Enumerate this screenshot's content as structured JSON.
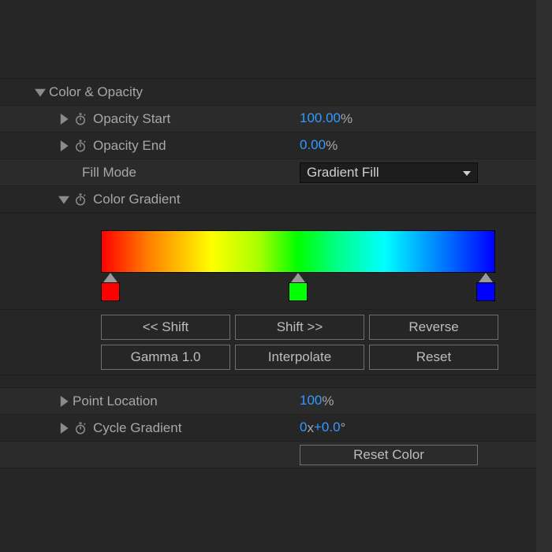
{
  "section": {
    "title": "Color & Opacity"
  },
  "props": {
    "opacityStart": {
      "label": "Opacity Start",
      "value": "100.00",
      "unit": "%"
    },
    "opacityEnd": {
      "label": "Opacity End",
      "value": "0.00",
      "unit": "%"
    },
    "fillMode": {
      "label": "Fill Mode",
      "value": "Gradient Fill"
    },
    "colorGradient": {
      "label": "Color Gradient"
    },
    "pointLocation": {
      "label": "Point Location",
      "value": "100",
      "unit": "%"
    },
    "cycleGradient": {
      "label": "Cycle Gradient",
      "value": "0",
      "sep": "x",
      "angle": "+0.0",
      "angleUnit": "°"
    }
  },
  "gradient": {
    "stops": [
      {
        "position": 0,
        "color": "#ff0000"
      },
      {
        "position": 50,
        "color": "#00ff00"
      },
      {
        "position": 100,
        "color": "#0000ff"
      }
    ]
  },
  "buttons": {
    "shiftLeft": "<< Shift",
    "shiftRight": "Shift >>",
    "reverse": "Reverse",
    "gamma": "Gamma 1.0",
    "interpolate": "Interpolate",
    "reset": "Reset",
    "resetColor": "Reset Color"
  }
}
